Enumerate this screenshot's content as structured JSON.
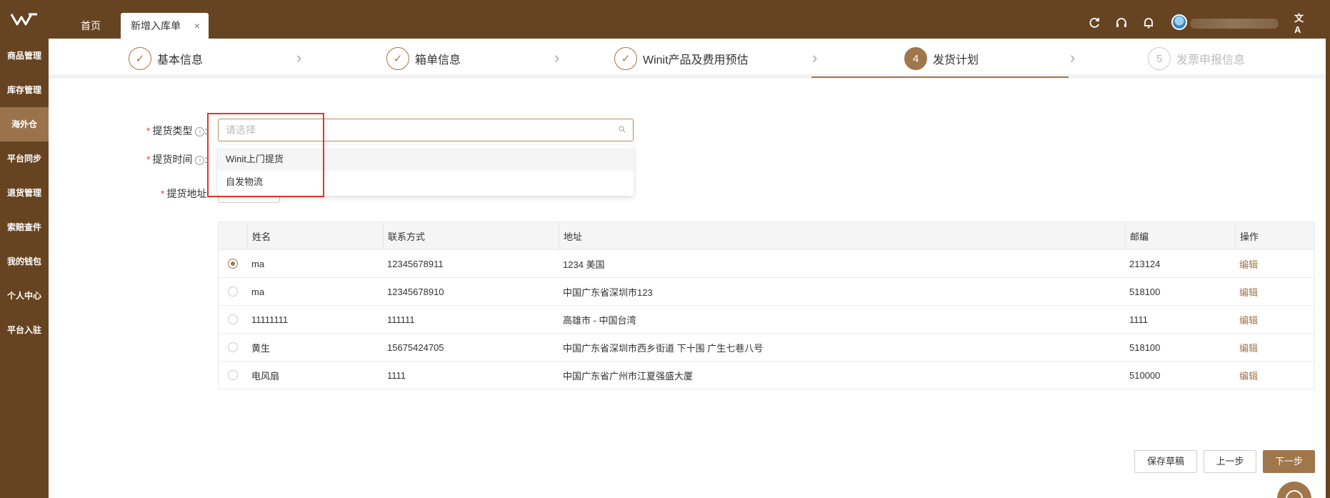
{
  "header": {
    "tabs": [
      {
        "label": "首页"
      },
      {
        "label": "新增入库单",
        "close": "×"
      }
    ],
    "icons": [
      "refresh-icon",
      "headset-icon",
      "bell-icon",
      "avatar",
      "translate-icon"
    ],
    "translate_glyph": "文A"
  },
  "sidebar": {
    "items": [
      {
        "label": "商品管理"
      },
      {
        "label": "库存管理"
      },
      {
        "label": "海外仓",
        "active": true
      },
      {
        "label": "平台同步"
      },
      {
        "label": "退货管理"
      },
      {
        "label": "索赔查件"
      },
      {
        "label": "我的钱包"
      },
      {
        "label": "个人中心"
      },
      {
        "label": "平台入驻"
      }
    ]
  },
  "steps": [
    {
      "label": "基本信息",
      "status": "done",
      "mark": "✓"
    },
    {
      "label": "箱单信息",
      "status": "done",
      "mark": "✓"
    },
    {
      "label": "Winit产品及费用预估",
      "status": "done",
      "mark": "✓"
    },
    {
      "label": "发货计划",
      "status": "current",
      "mark": "4"
    },
    {
      "label": "发票申报信息",
      "status": "todo",
      "mark": "5"
    }
  ],
  "form": {
    "pickup_type_label": "提货类型",
    "pickup_time_label": "提货时间",
    "pickup_address_label": "提货地址",
    "required_mark": "*",
    "colon": ":",
    "select_placeholder": "请选择",
    "options": [
      "Winit上门提货",
      "自发物流"
    ]
  },
  "table": {
    "headers": [
      "姓名",
      "联系方式",
      "地址",
      "邮编",
      "操作"
    ],
    "rows": [
      {
        "name": "ma",
        "contact": "12345678911",
        "address": "1234 美国",
        "zip": "213124",
        "action": "编辑",
        "selected": true
      },
      {
        "name": "ma",
        "contact": "12345678910",
        "address": "中国广东省深圳市123",
        "zip": "518100",
        "action": "编辑",
        "selected": false
      },
      {
        "name": "11111111",
        "contact": "111111",
        "address": "高雄市 - 中国台湾",
        "zip": "1111",
        "action": "编辑",
        "selected": false
      },
      {
        "name": "黄生",
        "contact": "15675424705",
        "address": "中国广东省深圳市西乡街道 下十围 广生七巷八号",
        "zip": "518100",
        "action": "编辑",
        "selected": false
      },
      {
        "name": "电风扇",
        "contact": "1111",
        "address": "中国广东省广州市江夏强盛大厦",
        "zip": "510000",
        "action": "编辑",
        "selected": false
      }
    ]
  },
  "actions": {
    "save_draft": "保存草稿",
    "prev": "上一步",
    "next": "下一步"
  },
  "colors": {
    "brand": "#674421",
    "accent": "#a0764b",
    "highlight": "#e8322b"
  }
}
